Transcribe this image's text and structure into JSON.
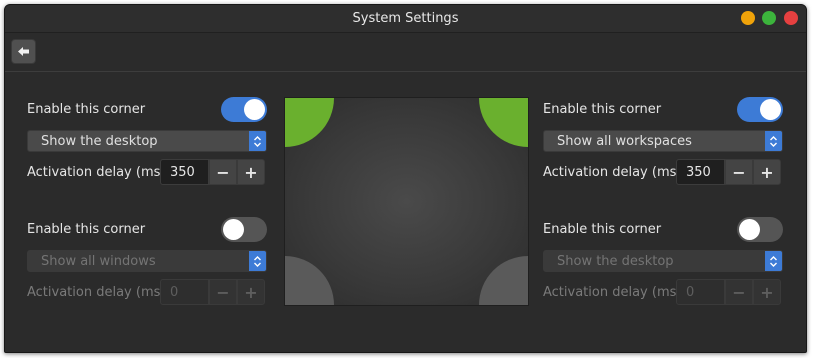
{
  "window": {
    "title": "System Settings",
    "buttons": {
      "minimize_color": "#f0a30a",
      "maximize_color": "#3cb43c",
      "close_color": "#e64040"
    }
  },
  "toolbar": {
    "back_icon": "back-arrow-icon"
  },
  "corners": {
    "top_left": {
      "enable_label": "Enable this corner",
      "enabled": true,
      "action": "Show the desktop",
      "delay_label": "Activation delay (ms)",
      "delay_value": "350",
      "minus": "−",
      "plus": "+"
    },
    "top_right": {
      "enable_label": "Enable this corner",
      "enabled": true,
      "action": "Show all workspaces",
      "delay_label": "Activation delay (ms)",
      "delay_value": "350",
      "minus": "−",
      "plus": "+"
    },
    "bottom_left": {
      "enable_label": "Enable this corner",
      "enabled": false,
      "action": "Show all windows",
      "delay_label": "Activation delay (ms)",
      "delay_value": "0",
      "minus": "−",
      "plus": "+"
    },
    "bottom_right": {
      "enable_label": "Enable this corner",
      "enabled": false,
      "action": "Show the desktop",
      "delay_label": "Activation delay (ms)",
      "delay_value": "0",
      "minus": "−",
      "plus": "+"
    }
  },
  "preview": {
    "active_color": "#6ab02e",
    "inactive_color": "#5a5a5a"
  }
}
